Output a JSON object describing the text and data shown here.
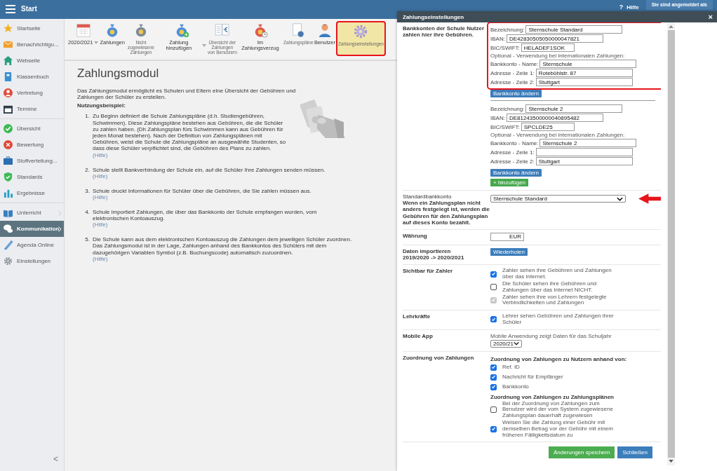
{
  "topbar": {
    "title": "Start",
    "help_icon": "?",
    "help": "Hilfe",
    "user": "Sie sind angemeldet als"
  },
  "sidebar": {
    "groups": [
      [
        {
          "label": "Startseite",
          "selected": false,
          "arrow": false
        },
        {
          "label": "Benachrichtigu...",
          "selected": false,
          "arrow": false
        },
        {
          "label": "Webseite",
          "selected": false,
          "arrow": false
        },
        {
          "label": "Klassenbuch",
          "selected": false,
          "arrow": false
        },
        {
          "label": "Vertretung",
          "selected": false,
          "arrow": false
        },
        {
          "label": "Termine",
          "selected": false,
          "arrow": false
        }
      ],
      [
        {
          "label": "Übersicht",
          "selected": false,
          "arrow": false
        },
        {
          "label": "Bewertung",
          "selected": false,
          "arrow": false
        },
        {
          "label": "Stoffverteilung...",
          "selected": false,
          "arrow": false
        },
        {
          "label": "Standards",
          "selected": false,
          "arrow": false
        },
        {
          "label": "Ergebnisse",
          "selected": false,
          "arrow": false
        }
      ],
      [
        {
          "label": "Unterricht",
          "selected": false,
          "arrow": true
        },
        {
          "label": "Kommunikation",
          "selected": true,
          "arrow": true
        },
        {
          "label": "Agenda Online",
          "selected": false,
          "arrow": false
        },
        {
          "label": "Einstellungen",
          "selected": false,
          "arrow": false
        }
      ]
    ],
    "collapse": "<"
  },
  "toolbar": [
    {
      "label": "2020/2021",
      "dropdown": true,
      "selected": false
    },
    {
      "label": "Zahlungen",
      "dropdown": false,
      "selected": false
    },
    {
      "label": "Nicht zugewiesene Zahlungen",
      "dropdown": false,
      "selected": false
    },
    {
      "label": "Zahlung hinzufügen",
      "dropdown": true,
      "selected": false
    },
    {
      "label": "Übersicht der Zahlungen von Benutzern",
      "dropdown": false,
      "selected": false
    },
    {
      "label": "Im Zahlungsverzug",
      "dropdown": false,
      "selected": false
    },
    {
      "label": "Zahlungspläne",
      "dropdown": false,
      "selected": false
    },
    {
      "label": "Benutzer",
      "dropdown": false,
      "selected": false
    },
    {
      "label": "Zahlungseinstellungen",
      "dropdown": false,
      "selected": true
    }
  ],
  "content": {
    "title": "Zahlungsmodul",
    "intro": "Das Zahlungsmodul ermöglicht es Schulen und Eltern eine Übersicht der Gebühren und Zahlungen der Schüler zu erstellen.",
    "example_heading": "Nutzungsbeispiel:",
    "steps": [
      {
        "number": "1.",
        "text": "Zu Beginn definiert die Schule Zahlungspläne (d.h. Studiengebühren, Schwimmen). Diese Zahlungspläne bestehen aus Gebühren, die die Schüler zu zahlen haben. (Dh Zahlungsplan fürs Schwimmen kann aus Gebühren für jeden Monat bestehen). Nach der Definition von Zahlungsplänen mit Gebühren, weist die Schule die Zahlungspläne an ausgewählte Studenten, so dass diese Schüler verpflichtet sind, die Gebühren des Plans zu zahlen.",
        "help": "(Hilfe)"
      },
      {
        "number": "2.",
        "text": "Schule stellt Bankverbindung der Schule ein, auf die Schüler Ihre Zahlungen senden müssen.",
        "help": "(Hilfe)"
      },
      {
        "number": "3.",
        "text": "Schule druckt Informationen für Schüler über die Gebühren, die Sie zahlen müssen aus.",
        "help": "(Hilfe)"
      },
      {
        "number": "4.",
        "text": "Schule importiert Zahlungen, die über das Bankkonto der Schule empfangen wurden, vom elektronischen Kontoauszug.",
        "help": "(Hilfe)"
      },
      {
        "number": "5.",
        "text": "Die Schule kann aus dem elektronischen Kontoauszug die Zahlungen dem jeweiligen Schüler zuordnen. Das Zahlungsmodul ist in der Lage, Zahlungen anhand des Bankkontos des Schülers mit dem dazugehörigen Variablen Symbol (z.B. Buchungscode) automatisch zuzuordnen.",
        "help": "(Hilfe)"
      }
    ]
  },
  "dialog": {
    "title": "Zahlungseinstellungen",
    "close": "×",
    "sections": [
      {
        "kind": "bank_accounts",
        "label": [
          "Bankkonten der Schule Nutzer zahlen hier ihre Gebühren."
        ],
        "accounts": [
          {
            "highlighted": true,
            "button": "Bankkonto ändern",
            "fields": [
              {
                "kind": "field",
                "label": "Bezeichnung:",
                "value": "Sternschule Standard"
              },
              {
                "kind": "field",
                "label": "IBAN:",
                "value": "DE42830505050000047821"
              },
              {
                "kind": "field",
                "label": "BIC/SWIFT:",
                "value": "HELADEF1SOK"
              },
              {
                "kind": "note",
                "label": "Optional - Verwendung bei internationalen Zahlungen:"
              },
              {
                "kind": "field",
                "label": "Bankkonto - Name:",
                "value": "Sternschule"
              },
              {
                "kind": "field",
                "label": "Adresse - Zeile 1:",
                "value": "Rotebühlstr. 87"
              },
              {
                "kind": "field",
                "label": "Adresse - Zeile 2:",
                "value": "Stuttgart"
              }
            ]
          },
          {
            "highlighted": false,
            "button": "Bankkonto ändern",
            "fields": [
              {
                "kind": "field",
                "label": "Bezeichnung:",
                "value": "Sternschule 2"
              },
              {
                "kind": "field",
                "label": "IBAN:",
                "value": "DE81243500000040895482"
              },
              {
                "kind": "field",
                "label": "BIC/SWIFT:",
                "value": "SPCLDE25"
              },
              {
                "kind": "note",
                "label": "Optional - Verwendung bei internationalen Zahlungen:"
              },
              {
                "kind": "field",
                "label": "Bankkonto - Name:",
                "value": "Sternschule 2"
              },
              {
                "kind": "field",
                "label": "Adresse - Zeile 1:"
              },
              {
                "kind": "field",
                "label": "Adresse - Zeile 2:",
                "value": "Stuttgart"
              }
            ]
          }
        ],
        "add_button": "+ hinzufügen"
      },
      {
        "kind": "select",
        "title": "Standardbankkonto",
        "label": [
          "Wenn ein Zahlungsplan nicht anders festgelegt ist, werden die Gebühren für den Zahlungsplan auf dieses Konto bezahlt."
        ],
        "value": "Sternschule Standard",
        "arrow_marker": true
      },
      {
        "kind": "currency",
        "label": [
          "Währung"
        ],
        "value": "EUR"
      },
      {
        "kind": "button",
        "label": [
          "Daten importieren",
          "2019/2020 -> 2020/2021"
        ],
        "button": "Wiederholen"
      },
      {
        "kind": "checkboxes",
        "label": [
          "Sichtbar für Zahler"
        ],
        "items": [
          {
            "text": "Zahler sehen ihre Gebühren und Zahlungen über das Internet.",
            "checked": true,
            "disabled": false
          },
          {
            "text": "Die Schüler sehen ihre Gebühren und Zahlungen über das Internet NICHT.",
            "checked": false,
            "disabled": false
          },
          {
            "text": "Zahler sehen ihre von Lehrern festgelegte Verbindlichkeiten und Zahlungen",
            "checked": true,
            "disabled": true
          }
        ]
      },
      {
        "kind": "checkboxes",
        "label": [
          "Lehrkräfte"
        ],
        "items": [
          {
            "text": "Lehrer sehen Gebühren und Zahlungen ihrer Schüler",
            "checked": true,
            "disabled": false
          }
        ]
      },
      {
        "kind": "mobile",
        "label": [
          "Mobile App"
        ],
        "text": "Mobile Anwendung zeigt Daten für das Schuljahr",
        "value": "2020/21"
      },
      {
        "kind": "assignment",
        "label": [
          "Zuordnung von Zahlungen"
        ],
        "groups": [
          {
            "heading": "Zuordnung von Zahlungen zu Nutzern anhand von:",
            "items": [
              {
                "text": "Ref. ID",
                "checked": true,
                "disabled": false
              },
              {
                "text": "Nachricht für Empfänger",
                "checked": true,
                "disabled": false
              },
              {
                "text": "Bankkonto",
                "checked": true,
                "disabled": false
              }
            ]
          },
          {
            "heading": "Zuordnung von Zahlungen zu Zahlungsplänen",
            "items": [
              {
                "text": "Bei der Zuordnung von Zahlungen zum Benutzer wird der vom System zugewiesene Zahlungsplan dauerhaft zugewiesen",
                "checked": false,
                "disabled": false
              },
              {
                "text": "Weisen Sie die Zahlung einer Gebühr mit demselben Betrag vor der Gebühr mit einem früheren Fälligkeitsdatum zu",
                "checked": true,
                "disabled": false
              }
            ]
          }
        ]
      }
    ],
    "buttons": [
      {
        "label": "Änderungen speichern",
        "kind": "primary"
      },
      {
        "label": "Schließen",
        "kind": "secondary"
      }
    ]
  }
}
